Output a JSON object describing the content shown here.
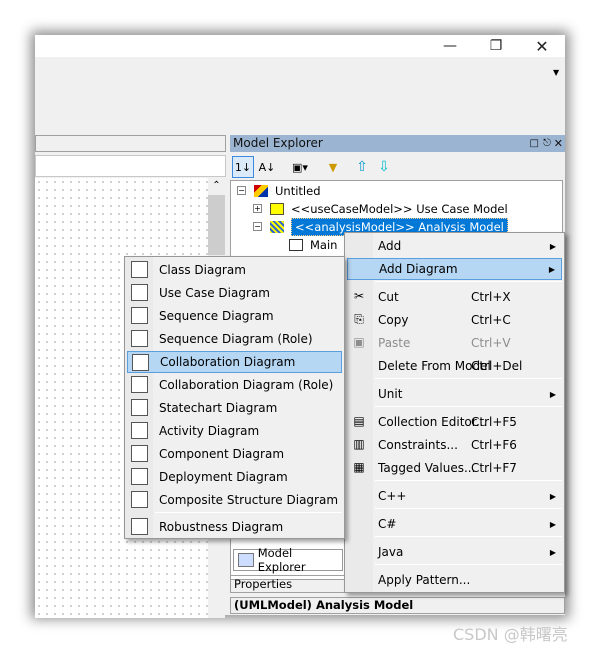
{
  "window": {
    "controls": [
      "minimize",
      "restore",
      "close"
    ]
  },
  "model_explorer": {
    "title": "Model Explorer",
    "tree": [
      {
        "label": "Untitled",
        "icon": "project-cube-icon",
        "expanded": true
      },
      {
        "label": "<<useCaseModel>> Use Case Model",
        "icon": "usecase-model-icon",
        "expanded": false
      },
      {
        "label": "<<analysisModel>> Analysis Model",
        "icon": "analysis-model-icon",
        "expanded": true,
        "selected": true
      },
      {
        "label": "Main",
        "icon": "class-diagram-icon"
      }
    ],
    "tab_label": "Model Explorer"
  },
  "properties": {
    "label": "Properties",
    "status": "(UMLModel) Analysis Model"
  },
  "context_menu": [
    {
      "label": "Add",
      "submenu": true
    },
    {
      "label": "Add Diagram",
      "submenu": true,
      "highlighted": true
    },
    {
      "label": "Cut",
      "shortcut": "Ctrl+X",
      "icon": "scissors-icon"
    },
    {
      "label": "Copy",
      "shortcut": "Ctrl+C",
      "icon": "copy-icon"
    },
    {
      "label": "Paste",
      "shortcut": "Ctrl+V",
      "icon": "paste-icon",
      "disabled": true
    },
    {
      "label": "Delete From Model",
      "shortcut": "Ctrl+Del"
    },
    {
      "label": "Unit",
      "submenu": true
    },
    {
      "label": "Collection Editor...",
      "shortcut": "Ctrl+F5",
      "icon": "collection-editor-icon"
    },
    {
      "label": "Constraints...",
      "shortcut": "Ctrl+F6",
      "icon": "constraints-icon"
    },
    {
      "label": "Tagged Values...",
      "shortcut": "Ctrl+F7",
      "icon": "tagged-values-icon"
    },
    {
      "label": "C++",
      "submenu": true
    },
    {
      "label": "C#",
      "submenu": true
    },
    {
      "label": "Java",
      "submenu": true
    },
    {
      "label": "Apply Pattern..."
    }
  ],
  "submenu": [
    "Class Diagram",
    "Use Case Diagram",
    "Sequence Diagram",
    "Sequence Diagram (Role)",
    "Collaboration Diagram",
    "Collaboration Diagram (Role)",
    "Statechart Diagram",
    "Activity Diagram",
    "Component Diagram",
    "Deployment Diagram",
    "Composite Structure Diagram",
    "Robustness Diagram"
  ],
  "submenu_highlighted": "Collaboration Diagram",
  "watermark": "CSDN @韩曙亮",
  "colors": {
    "selection": "#0078d7",
    "menu_highlight": "#b5d7f3",
    "panel_header": "#9bb4d1"
  }
}
